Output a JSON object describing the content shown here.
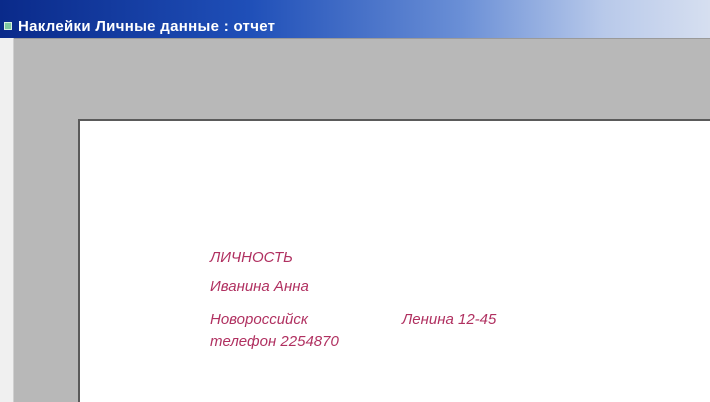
{
  "window": {
    "title": "Наклейки Личные данные : отчет",
    "icon": "access-report-icon"
  },
  "label": {
    "heading": "ЛИЧНОСТЬ",
    "name": "Иванина   Анна",
    "city": "Новороссийск",
    "address": "Ленина 12-45",
    "phone": "телефон  2254870"
  },
  "colors": {
    "title_bar_start": "#0a2a8a",
    "label_text": "#b03060",
    "preview_background": "#b8b8b8",
    "page_background": "#ffffff"
  }
}
